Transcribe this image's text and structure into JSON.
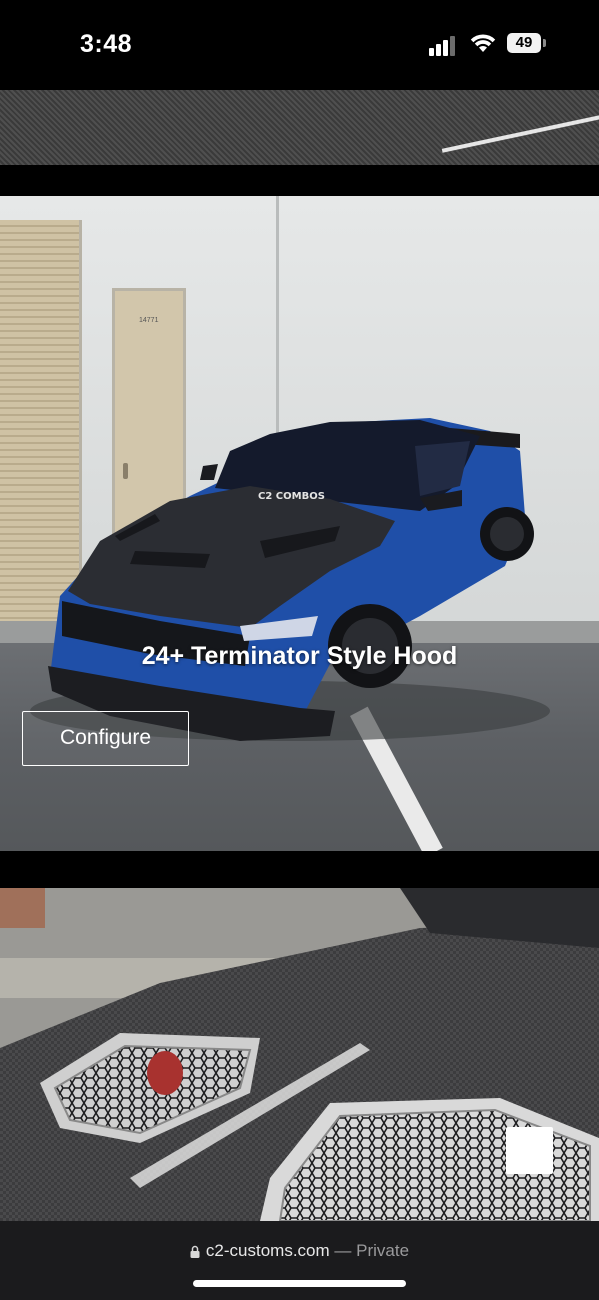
{
  "status_bar": {
    "time": "3:48",
    "battery_level": "49",
    "signal_bars_filled": 3,
    "icons": [
      "cellular-signal-icon",
      "wifi-icon",
      "battery-icon"
    ]
  },
  "product": {
    "title": "24+ Terminator Style Hood",
    "configure_label": "Configure",
    "door_number": "14771",
    "windshield_banner": "C2 COMBOS"
  },
  "browser": {
    "domain": "c2-customs.com",
    "separator": "—",
    "mode": "Private"
  },
  "colors": {
    "background": "#000000",
    "car_body": "#1f4fa8",
    "carbon": "#2b2d33",
    "url_bar": "#1b1b1d"
  }
}
